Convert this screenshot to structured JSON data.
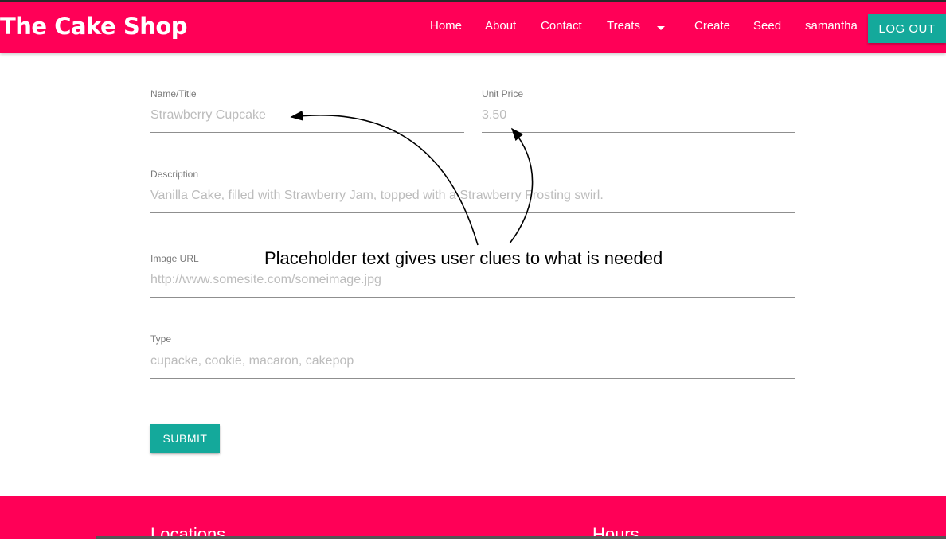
{
  "navbar": {
    "brand": "The Cake Shop",
    "links": {
      "home": "Home",
      "about": "About",
      "contact": "Contact",
      "treats": "Treats",
      "create": "Create",
      "seed": "Seed",
      "user": "samantha"
    },
    "logout_label": "LOG OUT"
  },
  "form": {
    "name": {
      "label": "Name/Title",
      "placeholder": "Strawberry Cupcake"
    },
    "price": {
      "label": "Unit Price",
      "placeholder": "3.50"
    },
    "description": {
      "label": "Description",
      "placeholder": "Vanilla Cake, filled with Strawberry Jam, topped with a Strawberry Frosting swirl."
    },
    "image_url": {
      "label": "Image URL",
      "placeholder": "http://www.somesite.com/someimage.jpg"
    },
    "type": {
      "label": "Type",
      "placeholder": "cupacke, cookie, macaron, cakepop"
    },
    "submit_label": "SUBMIT"
  },
  "annotation": {
    "text": "Placeholder text gives user clues to what is needed"
  },
  "footer": {
    "locations_heading": "Locations",
    "hours_heading": "Hours"
  },
  "colors": {
    "brand": "#ff0057",
    "accent": "#14a99b"
  },
  "icons": {
    "treats_dropdown": "chevron-down-icon",
    "annotation_arrows": "arrow-icon"
  }
}
